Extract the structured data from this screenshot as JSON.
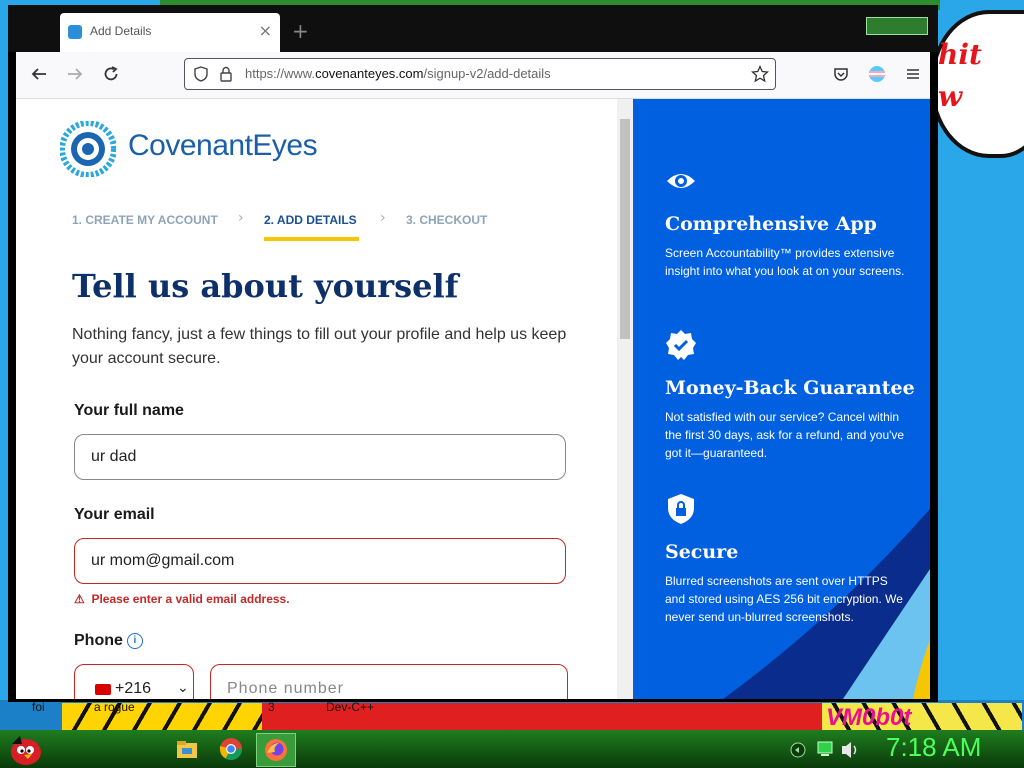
{
  "desktop": {
    "speech_text": "hit\nw",
    "labels": [
      "foi",
      "a rogue",
      "3",
      "Dev-C++"
    ],
    "vm_label": "VM0b0t"
  },
  "taskbar": {
    "clock": "7:18 AM"
  },
  "browser": {
    "tab": {
      "title": "Add Details",
      "close": "×"
    },
    "new_tab": "+",
    "url": {
      "prefix": "https://www.",
      "domain": "covenanteyes.com",
      "path": "/signup-v2/add-details"
    }
  },
  "page": {
    "logo_text": "CovenantEyes",
    "steps": [
      {
        "label": "1.  CREATE MY ACCOUNT",
        "active": false
      },
      {
        "label": "2.  ADD DETAILS",
        "active": true
      },
      {
        "label": "3.  CHECKOUT",
        "active": false
      }
    ],
    "step_separator": "›",
    "title": "Tell us about yourself",
    "subtitle": "Nothing fancy, just a few things to fill out your profile and help us keep your account secure.",
    "full_name": {
      "label": "Your full name",
      "value": "ur dad"
    },
    "email": {
      "label": "Your email",
      "value": "ur mom@gmail.com",
      "error": "Please enter a valid email address.",
      "error_icon": "⚠"
    },
    "phone": {
      "label": "Phone",
      "info_icon": "i",
      "country_code": "+216",
      "chevron": "⌄",
      "placeholder": "Phone number"
    }
  },
  "features": [
    {
      "icon": "eye-icon",
      "title": "Comprehensive App",
      "body": "Screen Accountability™ provides extensive insight into what you look at on your screens."
    },
    {
      "icon": "verified-badge-icon",
      "title": "Money-Back Guarantee",
      "body": "Not satisfied with our service? Cancel within the first 30 days, ask for a refund, and you've got it—guaranteed."
    },
    {
      "icon": "shield-lock-icon",
      "title": "Secure",
      "body": "Blurred screenshots are sent over HTTPS and stored using AES 256 bit encryption. We never send un-blurred screenshots."
    }
  ],
  "colors": {
    "brand_blue": "#0060df",
    "title_navy": "#0d2f6a",
    "step_accent": "#f6c700",
    "error_red": "#c62828",
    "clock_green": "#4cff5a"
  }
}
